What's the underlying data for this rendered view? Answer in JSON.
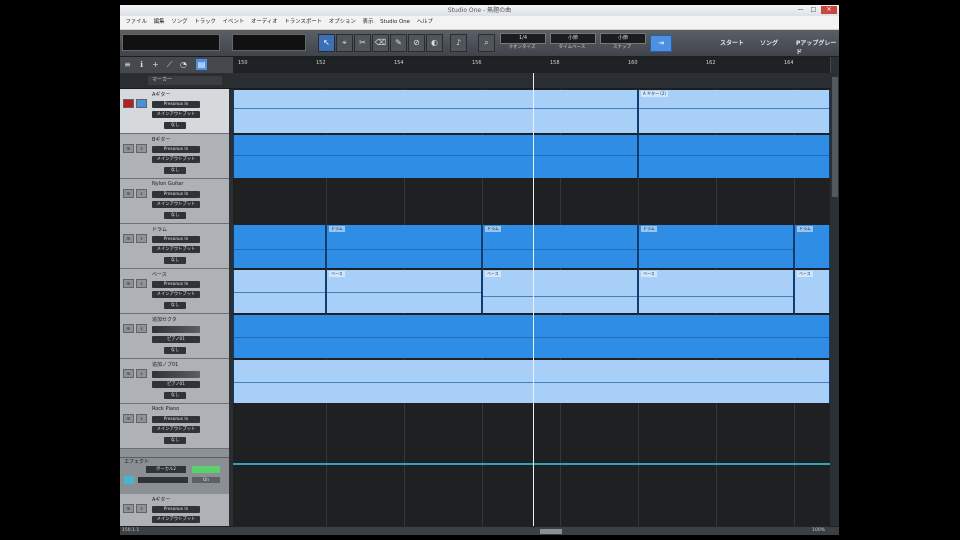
{
  "window": {
    "title": "Studio One - 無題の曲",
    "buttons": [
      "—",
      "□",
      "✕"
    ]
  },
  "menu": [
    "ファイル",
    "編集",
    "ソング",
    "トラック",
    "イベント",
    "オーディオ",
    "トランスポート",
    "オプション",
    "表示",
    "Studio One",
    "ヘルプ"
  ],
  "toolbar": {
    "quantize": {
      "value": "1/4",
      "label": "クオンタイズ"
    },
    "timebase": {
      "value": "小節",
      "label": "タイムベース"
    },
    "snap": {
      "value": "小節",
      "label": "スナップ"
    },
    "start_label": "スタート",
    "song_label": "ソング",
    "project_label": "Pアップグレード"
  },
  "ruler": {
    "bars": [
      "150",
      "152",
      "154",
      "156",
      "158",
      "160",
      "162",
      "164"
    ]
  },
  "marker_label": "マーカー",
  "tracks": [
    {
      "name": "Aギター",
      "input": "Presonus In",
      "output": "メインアウトプット",
      "mode": "なし",
      "selected": true
    },
    {
      "name": "Bギター",
      "input": "Presonus In",
      "output": "メインアウトプット",
      "mode": "なし",
      "selected": false
    },
    {
      "name": "Nylon Guitar",
      "input": "Presonus In",
      "output": "メインアウトプット",
      "mode": "なし",
      "selected": false
    },
    {
      "name": "ドラム",
      "input": "Presonus In",
      "output": "メインアウトプット",
      "mode": "なし",
      "selected": false
    },
    {
      "name": "ベース",
      "input": "Presonus In",
      "output": "メインアウトプット",
      "mode": "なし",
      "selected": false
    },
    {
      "name": "追加セクタ",
      "input": "",
      "output": "ピアノ01",
      "mode": "なし",
      "selected": false
    },
    {
      "name": "追加ノブ01",
      "input": "",
      "output": "ピアノ01",
      "mode": "なし",
      "selected": false
    },
    {
      "name": "Rock Piano",
      "input": "Presonus In",
      "output": "メインアウトプット",
      "mode": "なし",
      "selected": false
    }
  ],
  "fx": {
    "label": "エフェクト",
    "name": "ボーカル2",
    "on": "On"
  },
  "bottom_track": {
    "name": "Aギター",
    "input": "Presonus In",
    "output": "メインアウトプット"
  },
  "clips": {
    "a_guitar": [
      "A ギター (2)"
    ],
    "drums": [
      "ドラム",
      "ドラム",
      "ドラム",
      "ドラム"
    ],
    "bass": [
      "ベース",
      "ベース",
      "ベース",
      "ベース"
    ]
  },
  "status": {
    "left": "150.1.1",
    "zoom": "100%"
  },
  "colors": {
    "clip_light": "#a7cff8",
    "clip_bright": "#2f8de6",
    "accent": "#3b6fb6",
    "record": "#b3221e"
  }
}
